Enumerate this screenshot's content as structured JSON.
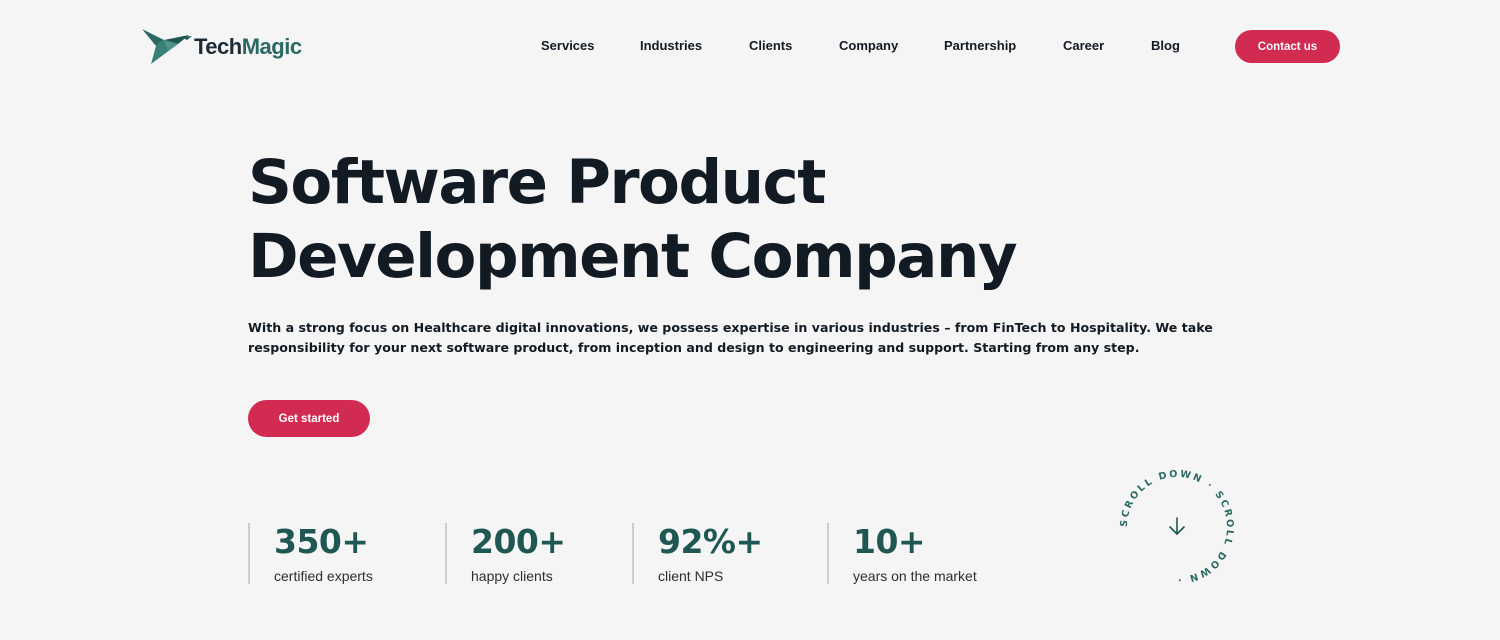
{
  "brand": {
    "name_part1": "Tech",
    "name_part2": "Magic",
    "icon": "hummingbird-logo-icon"
  },
  "nav": {
    "items": [
      {
        "label": "Services"
      },
      {
        "label": "Industries"
      },
      {
        "label": "Clients"
      },
      {
        "label": "Company"
      },
      {
        "label": "Partnership"
      },
      {
        "label": "Career"
      },
      {
        "label": "Blog"
      }
    ],
    "contact_label": "Contact us"
  },
  "hero": {
    "title_line1": "Software Product",
    "title_line2": "Development Company",
    "description": "With a strong focus on Healthcare digital innovations, we possess expertise in various industries – from FinTech to Hospitality. We take responsibility for your next software product, from inception and design to engineering and support. Starting from any step.",
    "cta_label": "Get started"
  },
  "stats": [
    {
      "value": "350+",
      "label": "certified experts"
    },
    {
      "value": "200+",
      "label": "happy clients"
    },
    {
      "value": "92%+",
      "label": "client NPS"
    },
    {
      "value": "10+",
      "label": "years on the market"
    }
  ],
  "scroll": {
    "text": "SCROLL DOWN · SCROLL DOWN · ",
    "icon": "arrow-down-icon"
  },
  "colors": {
    "accent": "#d12b52",
    "brand_green": "#2b6a64",
    "stat_green": "#1f5753",
    "text_dark": "#121b24",
    "background": "#f5f5f5"
  }
}
